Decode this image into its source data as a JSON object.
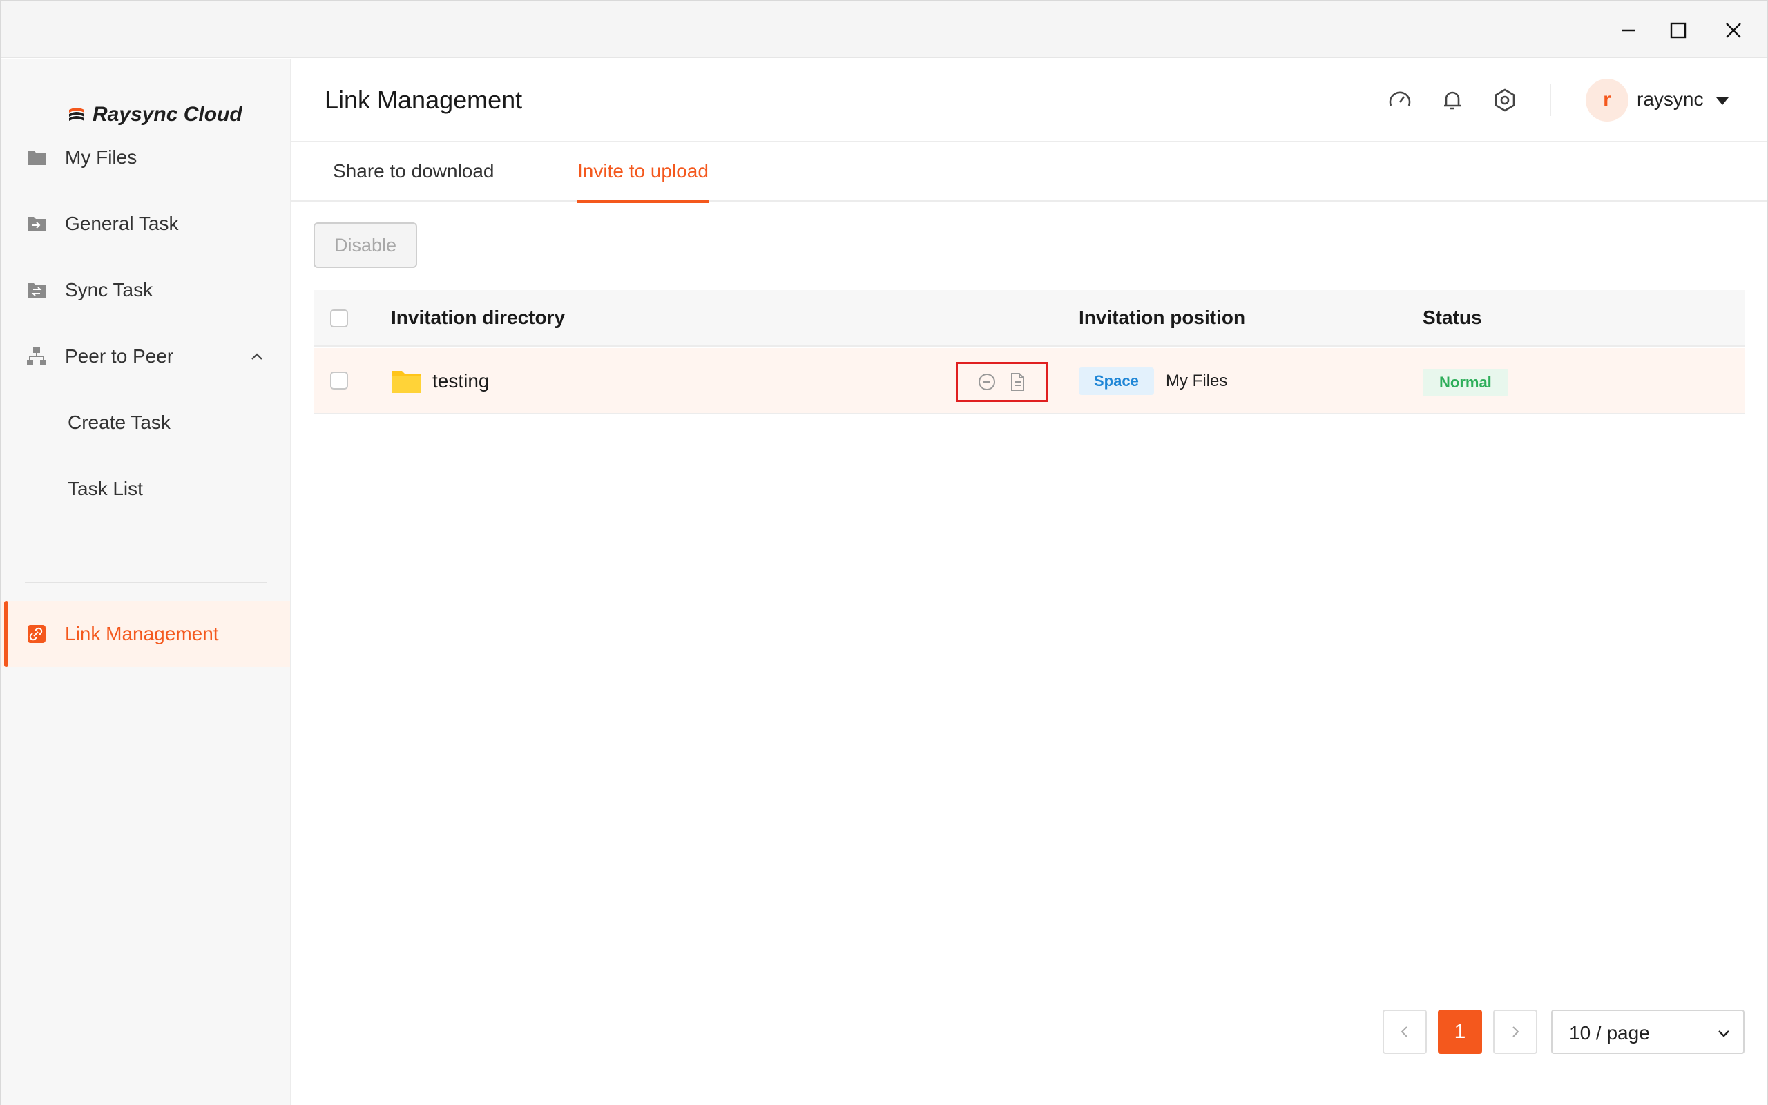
{
  "window": {
    "controls": {
      "minimize": "minimize-icon",
      "maximize": "maximize-icon",
      "close": "close-icon"
    }
  },
  "brand": {
    "name": "Raysync Cloud",
    "accent": "#f4581d"
  },
  "sidebar": {
    "items": [
      {
        "label": "My Files",
        "icon": "folder-icon"
      },
      {
        "label": "General Task",
        "icon": "folder-arrow-icon"
      },
      {
        "label": "Sync Task",
        "icon": "folder-sync-icon"
      },
      {
        "label": "Peer to Peer",
        "icon": "network-icon",
        "expanded": true
      },
      {
        "label": "Create Task",
        "sub": true
      },
      {
        "label": "Task List",
        "sub": true
      },
      {
        "label": "Link Management",
        "icon": "link-icon",
        "active": true
      }
    ]
  },
  "header": {
    "title": "Link Management",
    "icons": [
      "speedometer-icon",
      "bell-icon",
      "settings-icon"
    ],
    "user": {
      "initial": "r",
      "name": "raysync"
    }
  },
  "tabs": [
    {
      "label": "Share to download",
      "active": false
    },
    {
      "label": "Invite to upload",
      "active": true
    }
  ],
  "toolbar": {
    "disable_label": "Disable"
  },
  "table": {
    "columns": [
      "Invitation directory",
      "Invitation position",
      "Status"
    ],
    "rows": [
      {
        "directory": "testing",
        "position_tag": "Space",
        "position": "My Files",
        "status": "Normal",
        "actions": [
          "disable-icon",
          "document-icon"
        ]
      }
    ]
  },
  "pagination": {
    "current": "1",
    "page_size": "10 / page"
  },
  "colors": {
    "accent": "#f4581d",
    "space_tag": "#1f86d6",
    "normal_tag": "#2eae5a",
    "highlight_border": "#e02020"
  }
}
